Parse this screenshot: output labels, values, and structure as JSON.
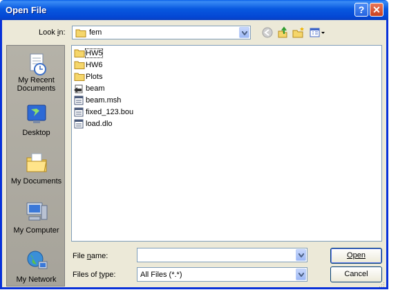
{
  "window": {
    "title": "Open File"
  },
  "lookin": {
    "label": "Look in:",
    "value": "fem"
  },
  "places": [
    {
      "label": "My Recent Documents",
      "icon": "recent-documents-icon"
    },
    {
      "label": "Desktop",
      "icon": "desktop-icon"
    },
    {
      "label": "My Documents",
      "icon": "my-documents-icon"
    },
    {
      "label": "My Computer",
      "icon": "my-computer-icon"
    },
    {
      "label": "My Network",
      "icon": "my-network-icon"
    }
  ],
  "files": [
    {
      "name": "HW5",
      "type": "folder"
    },
    {
      "name": "HW6",
      "type": "folder"
    },
    {
      "name": "Plots",
      "type": "folder"
    },
    {
      "name": "beam",
      "type": "shortcut"
    },
    {
      "name": "beam.msh",
      "type": "file"
    },
    {
      "name": "fixed_123.bou",
      "type": "file"
    },
    {
      "name": "load.dlo",
      "type": "file"
    }
  ],
  "form": {
    "filename_label": "File name:",
    "filename_value": "",
    "filetype_label": "Files of type:",
    "filetype_value": "All Files (*.*)"
  },
  "buttons": {
    "open": "Open",
    "cancel": "Cancel"
  }
}
